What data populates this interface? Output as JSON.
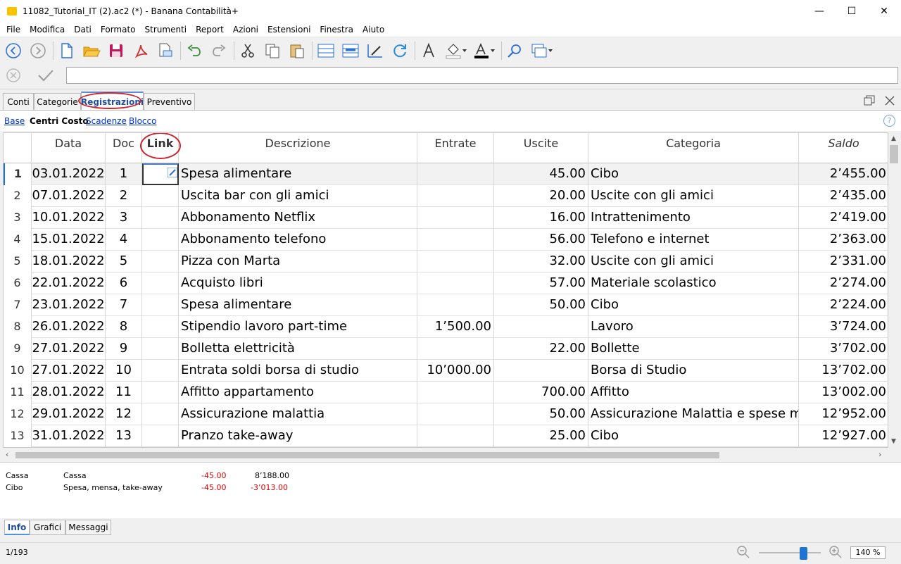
{
  "window": {
    "title": "11082_Tutorial_IT (2).ac2 (*) - Banana Contabilità+",
    "minimize": "—",
    "maximize": "☐",
    "close": "✕"
  },
  "menu": [
    "File",
    "Modifica",
    "Dati",
    "Formato",
    "Strumenti",
    "Report",
    "Azioni",
    "Estensioni",
    "Finestra",
    "Aiuto"
  ],
  "table_tabs": [
    "Conti",
    "Categorie",
    "Registrazioni",
    "Preventivo"
  ],
  "active_table_tab": "Registrazioni",
  "views": {
    "base": "Base",
    "centri": "Centri Costo",
    "scadenze": "Scadenze",
    "blocco": "Blocco",
    "help": "?"
  },
  "columns": {
    "data": "Data",
    "doc": "Doc",
    "link": "Link",
    "descrizione": "Descrizione",
    "entrate": "Entrate",
    "uscite": "Uscite",
    "categoria": "Categoria",
    "saldo": "Saldo"
  },
  "rows": [
    {
      "n": "1",
      "data": "03.01.2022",
      "doc": "1",
      "desc": "Spesa alimentare",
      "entrate": "",
      "uscite": "45.00",
      "cat": "Cibo",
      "saldo": "2’455.00"
    },
    {
      "n": "2",
      "data": "07.01.2022",
      "doc": "2",
      "desc": "Uscita bar con gli amici",
      "entrate": "",
      "uscite": "20.00",
      "cat": "Uscite con gli amici",
      "saldo": "2’435.00"
    },
    {
      "n": "3",
      "data": "10.01.2022",
      "doc": "3",
      "desc": "Abbonamento Netflix",
      "entrate": "",
      "uscite": "16.00",
      "cat": "Intrattenimento",
      "saldo": "2’419.00"
    },
    {
      "n": "4",
      "data": "15.01.2022",
      "doc": "4",
      "desc": "Abbonamento telefono",
      "entrate": "",
      "uscite": "56.00",
      "cat": "Telefono e internet",
      "saldo": "2’363.00"
    },
    {
      "n": "5",
      "data": "18.01.2022",
      "doc": "5",
      "desc": "Pizza con Marta",
      "entrate": "",
      "uscite": "32.00",
      "cat": "Uscite con gli amici",
      "saldo": "2’331.00"
    },
    {
      "n": "6",
      "data": "22.01.2022",
      "doc": "6",
      "desc": "Acquisto libri",
      "entrate": "",
      "uscite": "57.00",
      "cat": "Materiale scolastico",
      "saldo": "2’274.00"
    },
    {
      "n": "7",
      "data": "23.01.2022",
      "doc": "7",
      "desc": "Spesa alimentare",
      "entrate": "",
      "uscite": "50.00",
      "cat": "Cibo",
      "saldo": "2’224.00"
    },
    {
      "n": "8",
      "data": "26.01.2022",
      "doc": "8",
      "desc": "Stipendio lavoro part-time",
      "entrate": "1’500.00",
      "uscite": "",
      "cat": "Lavoro",
      "saldo": "3’724.00"
    },
    {
      "n": "9",
      "data": "27.01.2022",
      "doc": "9",
      "desc": "Bolletta elettricità",
      "entrate": "",
      "uscite": "22.00",
      "cat": "Bollette",
      "saldo": "3’702.00"
    },
    {
      "n": "10",
      "data": "27.01.2022",
      "doc": "10",
      "desc": "Entrata soldi borsa di studio",
      "entrate": "10’000.00",
      "uscite": "",
      "cat": "Borsa di Studio",
      "saldo": "13’702.00"
    },
    {
      "n": "11",
      "data": "28.01.2022",
      "doc": "11",
      "desc": "Affitto appartamento",
      "entrate": "",
      "uscite": "700.00",
      "cat": "Affitto",
      "saldo": "13’002.00"
    },
    {
      "n": "12",
      "data": "29.01.2022",
      "doc": "12",
      "desc": "Assicurazione malattia",
      "entrate": "",
      "uscite": "50.00",
      "cat": "Assicurazione Malattia e spese mediche",
      "saldo": "12’952.00"
    },
    {
      "n": "13",
      "data": "31.01.2022",
      "doc": "13",
      "desc": "Pranzo take-away",
      "entrate": "",
      "uscite": "25.00",
      "cat": "Cibo",
      "saldo": "12’927.00"
    }
  ],
  "info_lines": [
    {
      "account": "Cassa",
      "description": "Cassa",
      "amount": "-45.00",
      "balance": "8’188.00"
    },
    {
      "account": "Cibo",
      "description": "Spesa, mensa, take-away",
      "amount": "-45.00",
      "balance": "-3’013.00"
    }
  ],
  "bottom_tabs": [
    "Info",
    "Grafici",
    "Messaggi"
  ],
  "status": {
    "position": "1/193",
    "zoom": "140 %",
    "zoom_level_percent": 140
  },
  "colors": {
    "accent": "#1f4e9e",
    "highlight": "#d0202a",
    "negative": "#e00000",
    "link": "#0033cc"
  }
}
